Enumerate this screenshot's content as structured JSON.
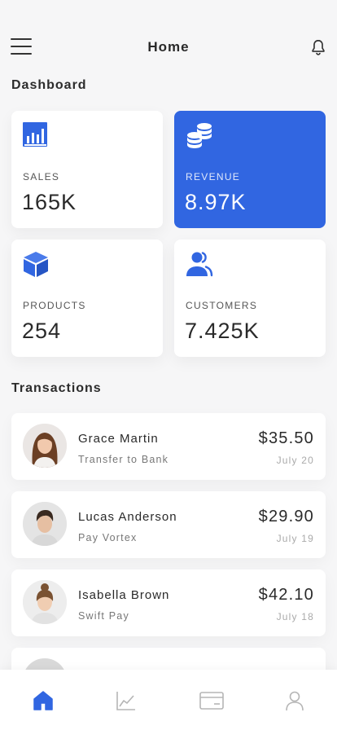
{
  "header": {
    "title": "Home",
    "menu_icon": "hamburger-menu-icon",
    "bell_icon": "bell-icon"
  },
  "dashboard": {
    "title": "Dashboard",
    "cards": [
      {
        "label": "SALES",
        "value": "165K",
        "icon": "bar-chart-icon"
      },
      {
        "label": "REVENUE",
        "value": "8.97K",
        "icon": "coins-icon"
      },
      {
        "label": "PRODUCTS",
        "value": "254",
        "icon": "box-icon"
      },
      {
        "label": "CUSTOMERS",
        "value": "7.425K",
        "icon": "users-icon"
      }
    ]
  },
  "transactions": {
    "title": "Transactions",
    "items": [
      {
        "name": "Grace Martin",
        "method": "Transfer to Bank",
        "amount": "$35.50",
        "date": "July 20"
      },
      {
        "name": "Lucas Anderson",
        "method": "Pay Vortex",
        "amount": "$29.90",
        "date": "July 19"
      },
      {
        "name": "Isabella Brown",
        "method": "Swift Pay",
        "amount": "$42.10",
        "date": "July 18"
      }
    ]
  },
  "bottom_nav": {
    "items": [
      {
        "icon": "home-icon",
        "active": true
      },
      {
        "icon": "line-chart-icon",
        "active": false
      },
      {
        "icon": "card-icon",
        "active": false
      },
      {
        "icon": "user-icon",
        "active": false
      }
    ]
  },
  "colors": {
    "accent": "#3166e1",
    "background": "#f6f6f7",
    "inactive_icon": "#b5b5b5"
  }
}
